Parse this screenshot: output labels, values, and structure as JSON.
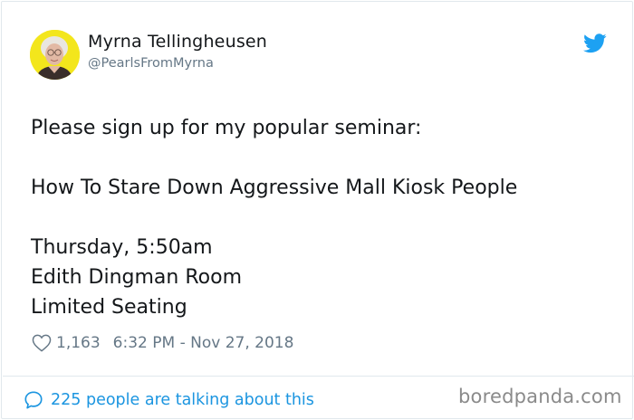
{
  "author": {
    "name": "Myrna Tellingheusen",
    "handle": "@PearlsFromMyrna",
    "avatar_icon": "profile-photo"
  },
  "platform_icon": "twitter-bird-icon",
  "tweet": {
    "lines": [
      "Please sign up for my popular seminar:",
      "",
      "How To Stare Down Aggressive Mall Kiosk People",
      "",
      "Thursday, 5:50am",
      "Edith Dingman Room",
      "Limited Seating"
    ]
  },
  "meta": {
    "likes": "1,163",
    "timestamp": "6:32 PM - Nov 27, 2018"
  },
  "footer": {
    "conversation_text": "225 people are talking about this"
  },
  "watermark": "boredpanda.com",
  "colors": {
    "accent": "#1b95e0",
    "bird": "#1da1f2",
    "muted": "#657786",
    "text": "#14171a",
    "avatar_bg": "#f3e61c"
  }
}
